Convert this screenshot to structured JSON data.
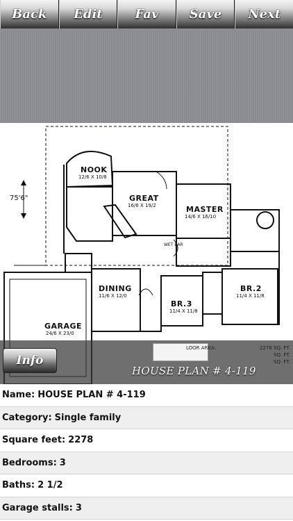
{
  "toolbar": {
    "back": "Back",
    "edit": "Edit",
    "fav": "Fav",
    "save": "Save",
    "next": "Next"
  },
  "plan": {
    "rooms": {
      "nook": "NOOK",
      "nook_dim": "12/6 X 10/8",
      "great": "GREAT",
      "great_dim": "16/6 X 19/2",
      "master": "MASTER",
      "master_dim": "14/6 X 16/10",
      "dining": "DINING",
      "dining_dim": "11/6 X 12/0",
      "br3": "BR.3",
      "br3_dim": "11/4 X 11/8",
      "br2": "BR.2",
      "br2_dim": "11/4 X 11/8",
      "garage": "GARAGE",
      "garage_dim": "24/6 X 23/0",
      "wet_bar": "WET BAR",
      "overall_dim": "75'6\""
    },
    "stats": [
      {
        "label": "LOOR AREA:",
        "value": "2278 SQ. FT."
      },
      {
        "label": "",
        "value": "SQ. FT."
      },
      {
        "label": "",
        "value": "SQ. FT."
      }
    ]
  },
  "caption": {
    "info_label": "Info",
    "title": "HOUSE PLAN # 4-119"
  },
  "details": [
    {
      "label": "Name:",
      "value": "HOUSE PLAN # 4-119"
    },
    {
      "label": "Category:",
      "value": "Single family"
    },
    {
      "label": "Square feet:",
      "value": "2278"
    },
    {
      "label": "Bedrooms:",
      "value": "3"
    },
    {
      "label": "Baths:",
      "value": "2 1/2"
    },
    {
      "label": "Garage stalls:",
      "value": "3"
    }
  ]
}
